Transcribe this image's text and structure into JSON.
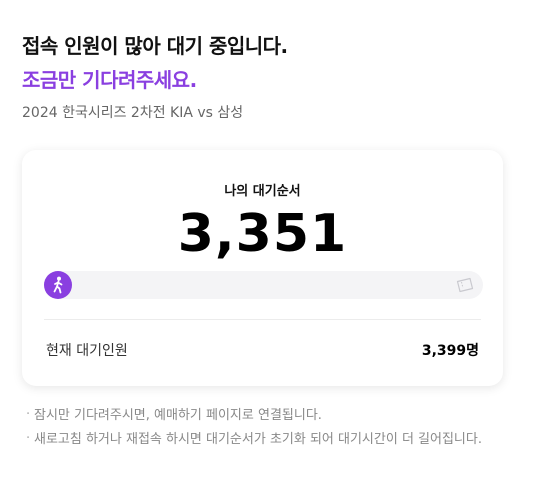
{
  "header": {
    "line1": "접속 인원이 많아 대기 중입니다.",
    "line2": "조금만 기다려주세요.",
    "match": "2024 한국시리즈 2차전 KIA vs 삼성"
  },
  "queue": {
    "label": "나의 대기순서",
    "position": "3,351",
    "progress_fraction": 0.0,
    "total_label": "현재 대기인원",
    "total_value": "3,399명"
  },
  "notes": [
    "잠시만 기다려주시면, 예매하기 페이지로 연결됩니다.",
    "새로고침 하거나 재접속 하시면 대기순서가 초기화 되어 대기시간이 더 길어집니다."
  ],
  "colors": {
    "accent": "#8a3fe0",
    "track": "#f4f4f6"
  },
  "icons": {
    "runner": "runner-icon",
    "ticket": "ticket-icon"
  }
}
